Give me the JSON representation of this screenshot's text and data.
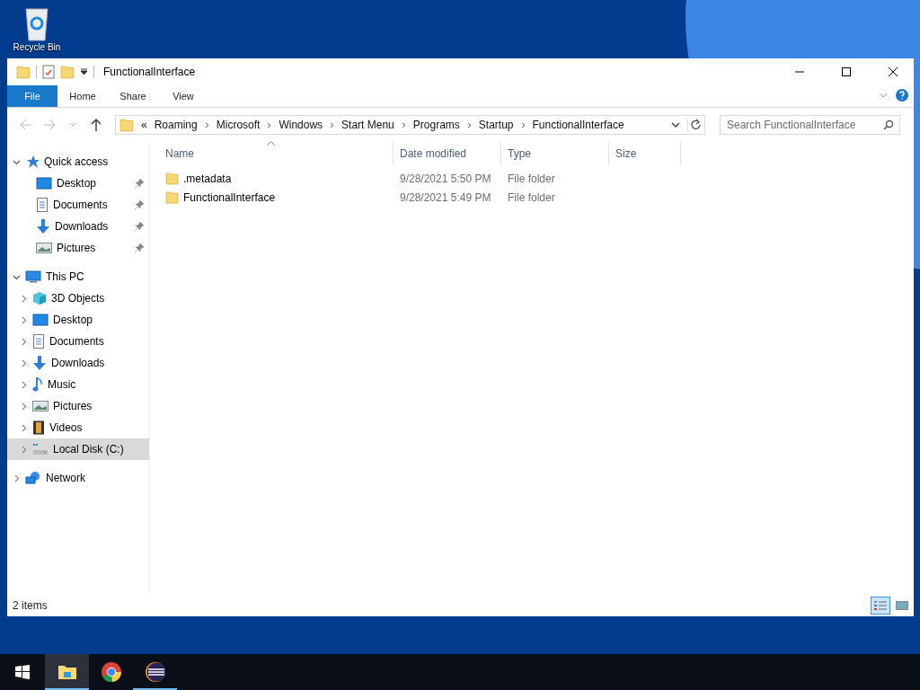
{
  "desktop": {
    "icons": [
      {
        "label": "Recycle Bin"
      }
    ]
  },
  "window": {
    "title": "FunctionalInterface"
  },
  "ribbon": {
    "tabs": [
      {
        "label": "File",
        "selected": true
      },
      {
        "label": "Home",
        "selected": false
      },
      {
        "label": "Share",
        "selected": false
      },
      {
        "label": "View",
        "selected": false
      }
    ]
  },
  "address_bar": {
    "overflow": "«",
    "path": [
      "Roaming",
      "Microsoft",
      "Windows",
      "Start Menu",
      "Programs",
      "Startup",
      "FunctionalInterface"
    ]
  },
  "search": {
    "placeholder": "Search FunctionalInterface"
  },
  "sidebar": {
    "items": [
      {
        "label": "Quick access",
        "expanded": true,
        "selected": false,
        "children": [
          {
            "label": "Desktop",
            "pinned": true,
            "selected": false
          },
          {
            "label": "Documents",
            "pinned": true,
            "selected": false
          },
          {
            "label": "Downloads",
            "pinned": true,
            "selected": false
          },
          {
            "label": "Pictures",
            "pinned": true,
            "selected": false
          }
        ]
      },
      {
        "label": "This PC",
        "expanded": true,
        "selected": false,
        "children": [
          {
            "label": "3D Objects",
            "expanded": false,
            "selected": false
          },
          {
            "label": "Desktop",
            "expanded": false,
            "selected": false
          },
          {
            "label": "Documents",
            "expanded": false,
            "selected": false
          },
          {
            "label": "Downloads",
            "expanded": false,
            "selected": false
          },
          {
            "label": "Music",
            "expanded": false,
            "selected": false
          },
          {
            "label": "Pictures",
            "expanded": false,
            "selected": false
          },
          {
            "label": "Videos",
            "expanded": false,
            "selected": false
          },
          {
            "label": "Local Disk (C:)",
            "expanded": false,
            "selected": true
          }
        ]
      },
      {
        "label": "Network",
        "expanded": false,
        "selected": false
      }
    ]
  },
  "table": {
    "columns": [
      {
        "label": "Name",
        "sorted": true
      },
      {
        "label": "Date modified",
        "sorted": false
      },
      {
        "label": "Type",
        "sorted": false
      },
      {
        "label": "Size",
        "sorted": false
      }
    ],
    "rows": [
      {
        "name": ".metadata",
        "date": "9/28/2021 5:50 PM",
        "type": "File folder",
        "size": ""
      },
      {
        "name": "FunctionalInterface",
        "date": "9/28/2021 5:49 PM",
        "type": "File folder",
        "size": ""
      }
    ]
  },
  "status_bar": {
    "count": "2 items",
    "views": [
      {
        "selected": true
      },
      {
        "selected": false
      }
    ]
  },
  "taskbar": {
    "apps": [
      {
        "selected": true,
        "running": true
      },
      {
        "selected": false,
        "running": false
      },
      {
        "selected": false,
        "running": true
      }
    ]
  }
}
